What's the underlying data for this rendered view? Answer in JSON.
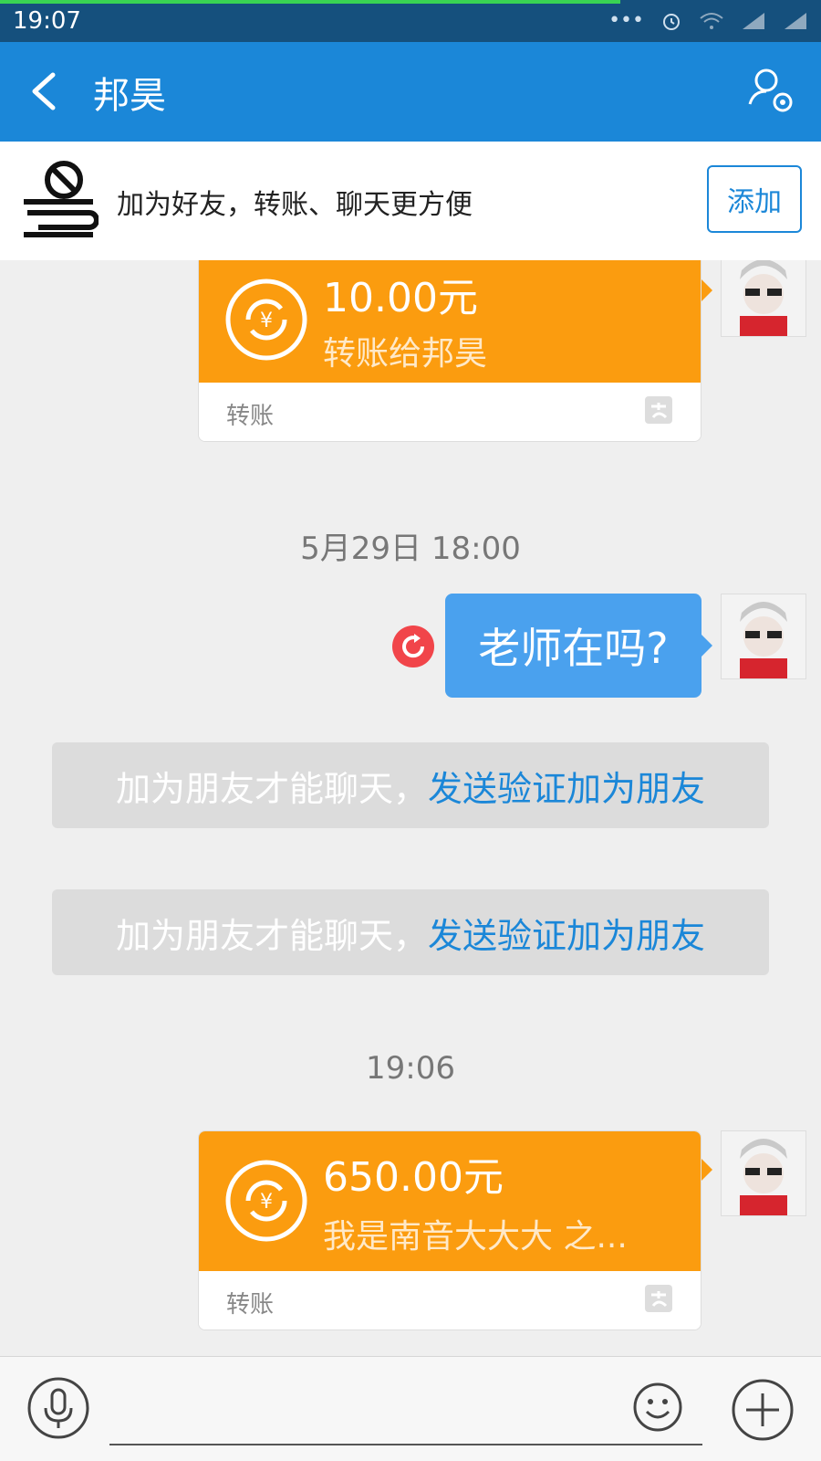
{
  "status_bar": {
    "time": "19:07",
    "progress": 0.755
  },
  "nav": {
    "title": "邦昊"
  },
  "banner": {
    "text": "加为好友，转账、聊天更方便",
    "add_label": "添加"
  },
  "messages": {
    "transfer1": {
      "amount": "10.00元",
      "note": "转账给邦昊",
      "type_label": "转账"
    },
    "timestamp1": "5月29日 18:00",
    "text1": "老师在吗?",
    "system1": {
      "prefix": "加为朋友才能聊天，",
      "link": "发送验证加为朋友"
    },
    "system2": {
      "prefix": "加为朋友才能聊天，",
      "link": "发送验证加为朋友"
    },
    "timestamp2": "19:06",
    "transfer2": {
      "amount": "650.00元",
      "note": "我是南音大大大  之...",
      "type_label": "转账"
    }
  },
  "colors": {
    "nav": "#1b87d8",
    "transfer": "#fb9c0f",
    "bubble": "#4aa1ee",
    "resend": "#f1454a"
  },
  "icons": [
    "back-icon",
    "profile-settings-icon",
    "transfer-icon",
    "alipay-icon",
    "resend-icon",
    "voice-icon",
    "emoji-icon",
    "plus-icon"
  ]
}
